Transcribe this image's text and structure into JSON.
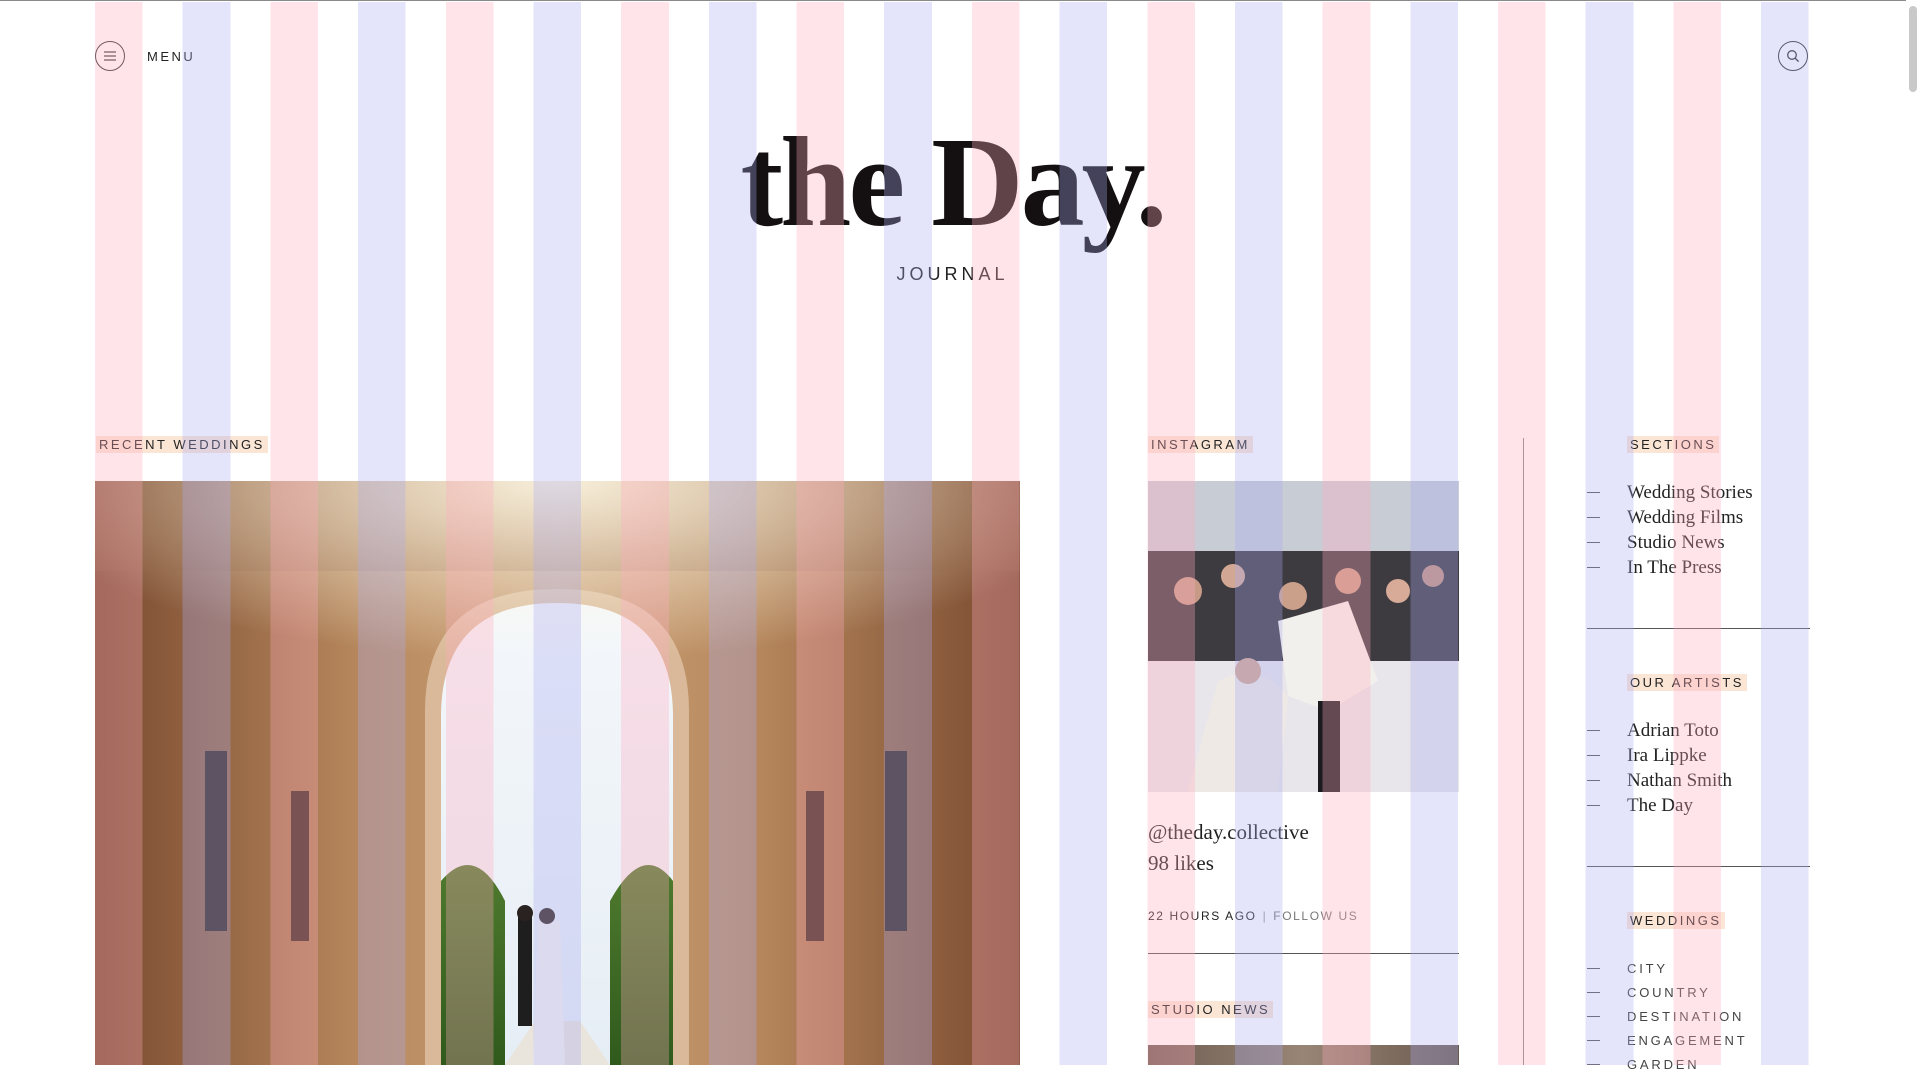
{
  "header": {
    "menu_label": "MENU",
    "logo": "the Day.",
    "subtitle": "JOURNAL"
  },
  "recent_weddings": {
    "label": "RECENT WEDDINGS"
  },
  "instagram": {
    "label": "INSTAGRAM",
    "handle": "@theday.collective",
    "likes": "98 likes",
    "time": "22 HOURS AGO",
    "separator": "|",
    "follow": "FOLLOW US"
  },
  "studio_news": {
    "label": "STUDIO NEWS"
  },
  "sidebar": {
    "sections_label": "SECTIONS",
    "sections": [
      "Wedding Stories",
      "Wedding Films",
      "Studio News",
      "In The Press"
    ],
    "artists_label": "OUR ARTISTS",
    "artists": [
      "Adrian Toto",
      "Ira Lippke",
      "Nathan Smith",
      "The Day"
    ],
    "weddings_label": "WEDDINGS",
    "weddings": [
      "CITY",
      "COUNTRY",
      "DESTINATION",
      "ENGAGEMENT",
      "GARDEN"
    ]
  },
  "icons": {
    "menu": "hamburger-icon",
    "search": "search-icon"
  }
}
